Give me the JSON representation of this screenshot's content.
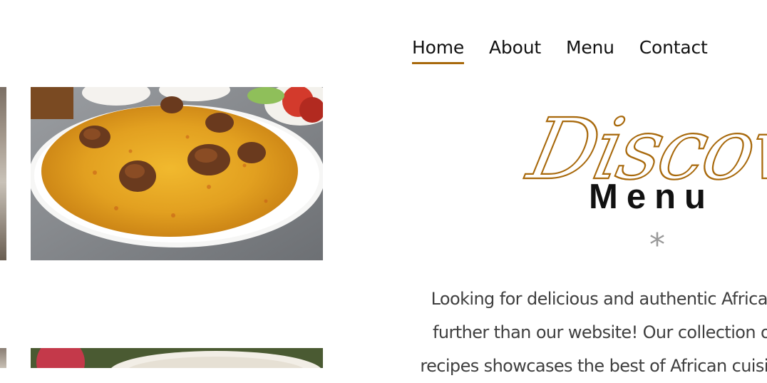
{
  "nav": {
    "items": [
      {
        "label": "Home",
        "active": true
      },
      {
        "label": "About",
        "active": false
      },
      {
        "label": "Menu",
        "active": false
      },
      {
        "label": "Contact",
        "active": false
      }
    ]
  },
  "hero": {
    "script_text": "Discover",
    "title": "Menu",
    "divider_glyph": "*",
    "intro_lines": [
      "Looking for delicious and authentic African",
      "further than our website! Our collection of",
      "recipes showcases the best of African cuisine"
    ]
  },
  "colors": {
    "accent": "#a8690c",
    "text_dark": "#111111",
    "text_body": "#3f3f3f",
    "divider": "#999999"
  },
  "images": {
    "main_photo": "jollof-rice-with-meat-photo",
    "bottom_photo": "dish-photo-partial"
  }
}
